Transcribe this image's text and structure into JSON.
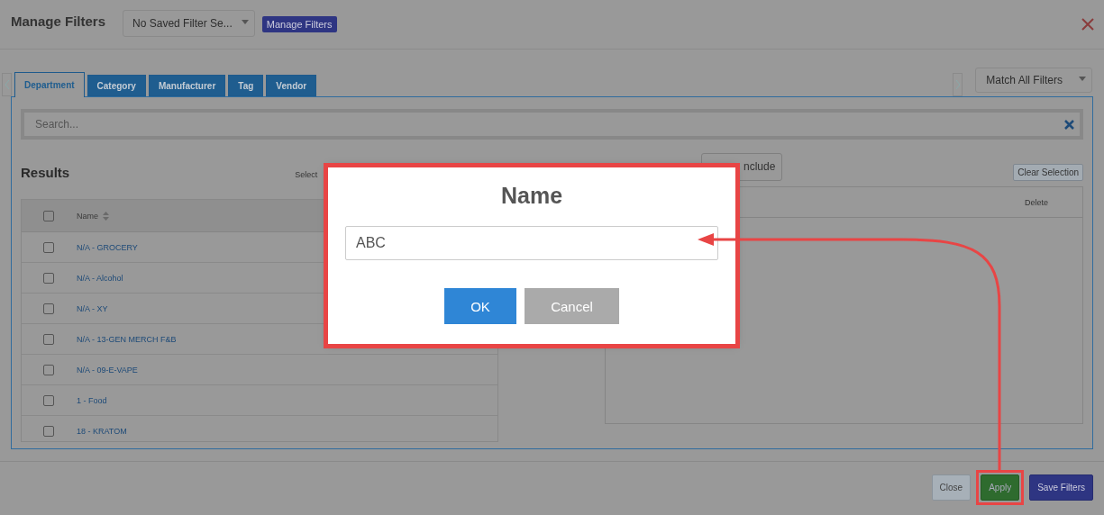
{
  "window": {
    "title": "Manage Filters"
  },
  "saved_filter_select": {
    "value": "No Saved Filter Se..."
  },
  "manage_filters_button": "Manage Filters",
  "tabs": [
    {
      "label": "Department",
      "selected": true
    },
    {
      "label": "Category",
      "selected": false
    },
    {
      "label": "Manufacturer",
      "selected": false
    },
    {
      "label": "Tag",
      "selected": false
    },
    {
      "label": "Vendor",
      "selected": false
    }
  ],
  "match_select": {
    "value": "Match All Filters"
  },
  "search": {
    "placeholder": "Search..."
  },
  "results": {
    "title": "Results",
    "select_label": "Select",
    "select_all_checked": false,
    "columns": [
      "Name"
    ],
    "rows": [
      {
        "name": "N/A - GROCERY",
        "checked": false
      },
      {
        "name": "N/A - Alcohol",
        "checked": false
      },
      {
        "name": "N/A - XY",
        "checked": false
      },
      {
        "name": "N/A - 13-GEN MERCH F&B",
        "checked": false
      },
      {
        "name": "N/A - 09-E-VAPE",
        "checked": false
      },
      {
        "name": "1 - Food",
        "checked": false
      },
      {
        "name": "18 - KRATOM",
        "checked": false
      }
    ]
  },
  "selected_panel": {
    "include_button": "nclude",
    "clear_button": "Clear Selection",
    "columns": [
      "Delete"
    ]
  },
  "footer_buttons": [
    {
      "label": "Close",
      "kind": "close",
      "highlighted": false
    },
    {
      "label": "Apply",
      "kind": "apply",
      "highlighted": true
    },
    {
      "label": "Save Filters",
      "kind": "save",
      "highlighted": false
    }
  ],
  "dialog": {
    "title": "Name",
    "input_value": "ABC",
    "highlighted": true,
    "buttons": [
      {
        "label": "OK",
        "kind": "primary"
      },
      {
        "label": "Cancel",
        "kind": "secondary"
      }
    ]
  }
}
